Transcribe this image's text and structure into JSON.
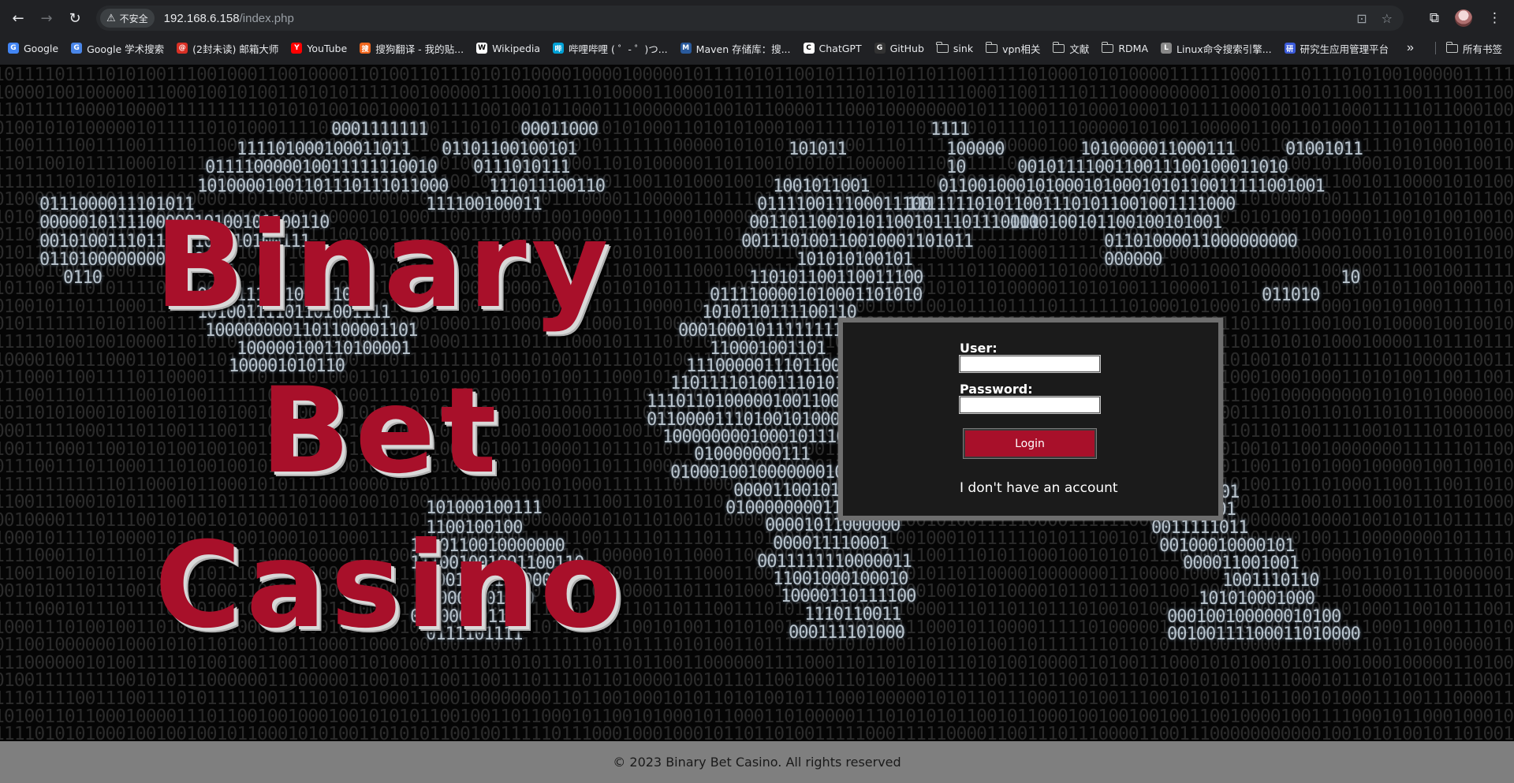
{
  "browser": {
    "security_label": "不安全",
    "url_host": "192.168.6.158",
    "url_path": "/index.php",
    "bookmarks": [
      {
        "label": "Google",
        "icon": "google-icon",
        "color": "#4285f4"
      },
      {
        "label": "Google 学术搜索",
        "icon": "scholar-icon",
        "color": "#4a86e8"
      },
      {
        "label": "(2封未读) 邮箱大师",
        "icon": "mail-master-icon",
        "color": "#d93025"
      },
      {
        "label": "YouTube",
        "icon": "youtube-icon",
        "color": "#ff0000"
      },
      {
        "label": "搜狗翻译 - 我的贴...",
        "icon": "sogou-icon",
        "color": "#f0661d"
      },
      {
        "label": "Wikipedia",
        "icon": "wikipedia-icon",
        "color": "#ffffff"
      },
      {
        "label": "哔哩哔哩 ( ゜- ゜)つ...",
        "icon": "bilibili-icon",
        "color": "#00a1d6"
      },
      {
        "label": "Maven 存储库：搜...",
        "icon": "maven-icon",
        "color": "#2a5a9c"
      },
      {
        "label": "ChatGPT",
        "icon": "chatgpt-icon",
        "color": "#ffffff"
      },
      {
        "label": "GitHub",
        "icon": "github-icon",
        "color": "#333333"
      },
      {
        "label": "sink",
        "icon": "folder-icon"
      },
      {
        "label": "vpn相关",
        "icon": "folder-icon"
      },
      {
        "label": "文献",
        "icon": "folder-icon"
      },
      {
        "label": "RDMA",
        "icon": "folder-icon"
      },
      {
        "label": "Linux命令搜索引擎...",
        "icon": "linux-icon",
        "color": "#888888"
      },
      {
        "label": "研究生应用管理平台",
        "icon": "university-icon",
        "color": "#3b5bdb"
      }
    ],
    "all_bookmarks_label": "所有书签"
  },
  "hero": {
    "line1": "Binary",
    "line2": "Bet",
    "line3": "Casino"
  },
  "login": {
    "user_label": "User:",
    "user_value": "",
    "password_label": "Password:",
    "password_value": "",
    "button_label": "Login",
    "no_account_link": "I don't have an account"
  },
  "footer": {
    "text": "© 2023 Binary Bet Casino. All rights reserved"
  },
  "colors": {
    "accent": "#a8102a",
    "footer_bg": "#7f7f7f",
    "chrome_bg": "#202124"
  }
}
